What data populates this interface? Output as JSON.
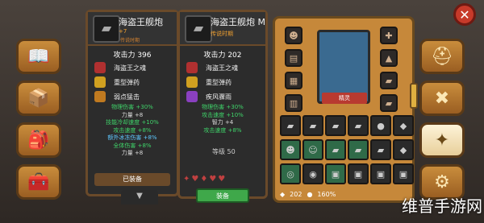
{
  "close_icon": "close-icon",
  "left_menu": [
    {
      "icon": "book-icon",
      "glyph": "📖"
    },
    {
      "icon": "box-icon",
      "glyph": "📦"
    },
    {
      "icon": "bag-icon",
      "glyph": "🎒"
    },
    {
      "icon": "chest-icon",
      "glyph": "🧰"
    }
  ],
  "right_menu": [
    {
      "icon": "helmet-icon",
      "glyph": "⛑"
    },
    {
      "icon": "crossed-tools-icon",
      "glyph": "✖"
    },
    {
      "icon": "gear-cross-icon",
      "glyph": "✦",
      "active": true
    },
    {
      "icon": "gear-icon",
      "glyph": "⚙"
    }
  ],
  "weapon_left": {
    "title": "海盗王舰炮",
    "sub": "+7",
    "sub2": "传说时期",
    "attack": "攻击力 396",
    "parts": [
      "海盗王之魂",
      "重型弹药",
      "弱点猛击"
    ],
    "stats": [
      {
        "text": "物理伤害 +30%",
        "cls": "green"
      },
      {
        "text": "力量 +8",
        "cls": "white"
      },
      {
        "text": "技能冷却速度 +10%",
        "cls": "green"
      },
      {
        "text": "攻击速度 +8%",
        "cls": "green"
      },
      {
        "text": "额外冰冻伤害 +8%",
        "cls": "blue"
      },
      {
        "text": "全体伤害 +8%",
        "cls": "green"
      },
      {
        "text": "力量 +8",
        "cls": "white"
      }
    ],
    "equipped": "已装备"
  },
  "weapon_right": {
    "title": "海盗王舰炮 M",
    "sub2": "传说时期",
    "attack": "攻击力 202",
    "parts": [
      "海盗王之魂",
      "重型弹药",
      "疾风骤雨"
    ],
    "stats": [
      {
        "text": "物理伤害 +30%",
        "cls": "green"
      },
      {
        "text": "攻击速度 +10%",
        "cls": "green"
      },
      {
        "text": "智力 +4",
        "cls": "white"
      },
      {
        "text": "攻击速度 +8%",
        "cls": "green"
      }
    ],
    "level": "等级 50",
    "equip_button": "装备"
  },
  "character": {
    "name": "精灵"
  },
  "currency": {
    "gems": "202",
    "gold": "160%"
  },
  "watermark": "维普手游网"
}
